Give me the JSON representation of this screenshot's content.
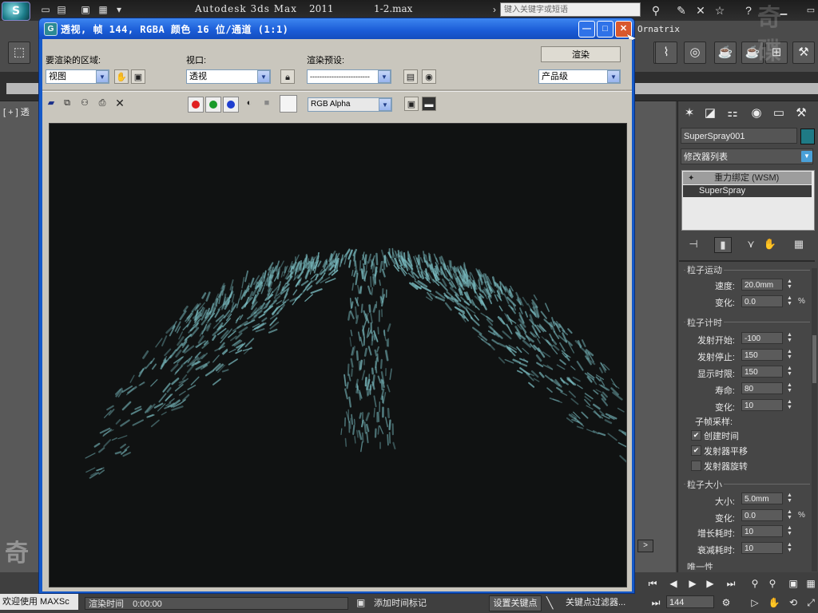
{
  "app": {
    "logo": "S",
    "title": "Autodesk 3ds Max",
    "version": "2011",
    "file": "1-2.max",
    "search_placeholder": "键入关键字或短语",
    "plugin_label": "Ornatrix",
    "watermark": "奇碟视频"
  },
  "viewport": {
    "label": "[ + ] 透"
  },
  "render_window": {
    "title": "透视, 帧 144, RGBA 颜色 16 位/通道 (1:1)",
    "area_label": "要渲染的区域:",
    "area_value": "视图",
    "viewport_label": "视口:",
    "viewport_value": "透视",
    "preset_label": "渲染预设:",
    "preset_value": "-------------------------",
    "render_button": "渲染",
    "quality_value": "产品级",
    "channel_value": "RGB Alpha",
    "channels": {
      "red": "#e02020",
      "green": "#1a9a2a",
      "blue": "#1f3fd0"
    },
    "icons": [
      "save-icon",
      "copy-icon",
      "clone-icon",
      "print-icon",
      "clear-icon"
    ]
  },
  "command_panel": {
    "object_name": "SuperSpray001",
    "object_color": "#1f7a85",
    "modifier_list": "修改器列表",
    "stack": [
      "重力绑定 (WSM)",
      "SuperSpray"
    ],
    "partial_rollout_title": "粒子运动",
    "speed": {
      "label": "速度:",
      "value": "20.0mm"
    },
    "speed_var": {
      "label": "变化:",
      "value": "0.0",
      "unit": "%"
    },
    "timing_title": "粒子计时",
    "emit_start": {
      "label": "发射开始:",
      "value": "-100"
    },
    "emit_stop": {
      "label": "发射停止:",
      "value": "150"
    },
    "display_until": {
      "label": "显示时限:",
      "value": "150"
    },
    "life": {
      "label": "寿命:",
      "value": "80"
    },
    "life_var": {
      "label": "变化:",
      "value": "10"
    },
    "subframe_label": "子帧采样:",
    "checks": [
      {
        "label": "创建时间",
        "checked": true
      },
      {
        "label": "发射器平移",
        "checked": true
      },
      {
        "label": "发射器旋转",
        "checked": false
      }
    ],
    "size_title": "粒子大小",
    "size": {
      "label": "大小:",
      "value": "5.0mm"
    },
    "size_var": {
      "label": "变化:",
      "value": "0.0",
      "unit": "%"
    },
    "grow_for": {
      "label": "增长耗时:",
      "value": "10"
    },
    "fade_for": {
      "label": "衰减耗时:",
      "value": "10"
    },
    "partial_next": "唯一性"
  },
  "status": {
    "welcome": "欢迎使用 MAXSc",
    "render_time_label": "渲染时间",
    "render_time_value": "0:00:00",
    "add_time_tag": "添加时间标记",
    "set_key": "设置关键点",
    "key_filters": "关键点过滤器...",
    "frame": "144",
    "timeline_next": ">"
  }
}
